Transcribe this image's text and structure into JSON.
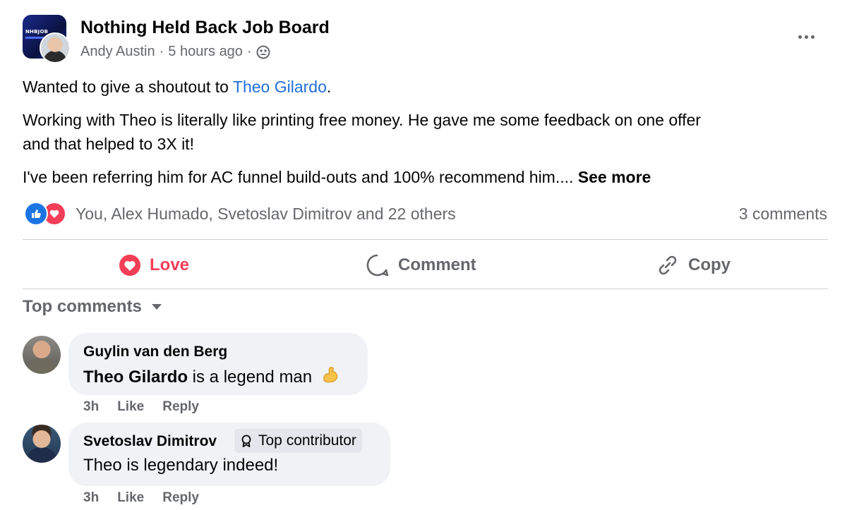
{
  "post": {
    "group_name": "Nothing Held Back Job Board",
    "group_logo_text": "NHBJOB",
    "author": "Andy Austin",
    "time": "5 hours ago",
    "separator": "·",
    "audience_icon": "group-icon",
    "paragraphs": {
      "p1_before": "Wanted to give a shoutout to ",
      "p1_mention": "Theo Gilardo",
      "p1_after": ".",
      "p2_line1": "Working with Theo is literally like printing free money. He gave me some feedback on one offer",
      "p2_line2": "and that helped to 3X it!",
      "p3": "I've been referring him for AC funnel build-outs and 100% recommend him.... ",
      "see_more": "See more"
    },
    "reactions_text": "You, Alex Humado, Svetoslav Dimitrov and 22 others",
    "reaction_icons": [
      "like-icon",
      "love-icon"
    ],
    "comments_count": "3 comments"
  },
  "actions": {
    "love": "Love",
    "comment": "Comment",
    "copy": "Copy"
  },
  "top_comments_label": "Top comments",
  "comments": [
    {
      "name": "Guylin van den Berg",
      "mention": "Theo Gilardo",
      "text": " is a legend man",
      "emoji": "flexed-biceps-icon",
      "time": "3h",
      "like": "Like",
      "reply": "Reply"
    },
    {
      "name": "Svetoslav Dimitrov",
      "badge": "Top contributor",
      "text": "Theo is legendary indeed!",
      "time": "3h",
      "like": "Like",
      "reply": "Reply"
    }
  ],
  "colors": {
    "link": "#216fdb",
    "love": "#f33e58",
    "like": "#1b74e4",
    "secondary_text": "#65676b",
    "bubble": "#f0f2f5"
  }
}
